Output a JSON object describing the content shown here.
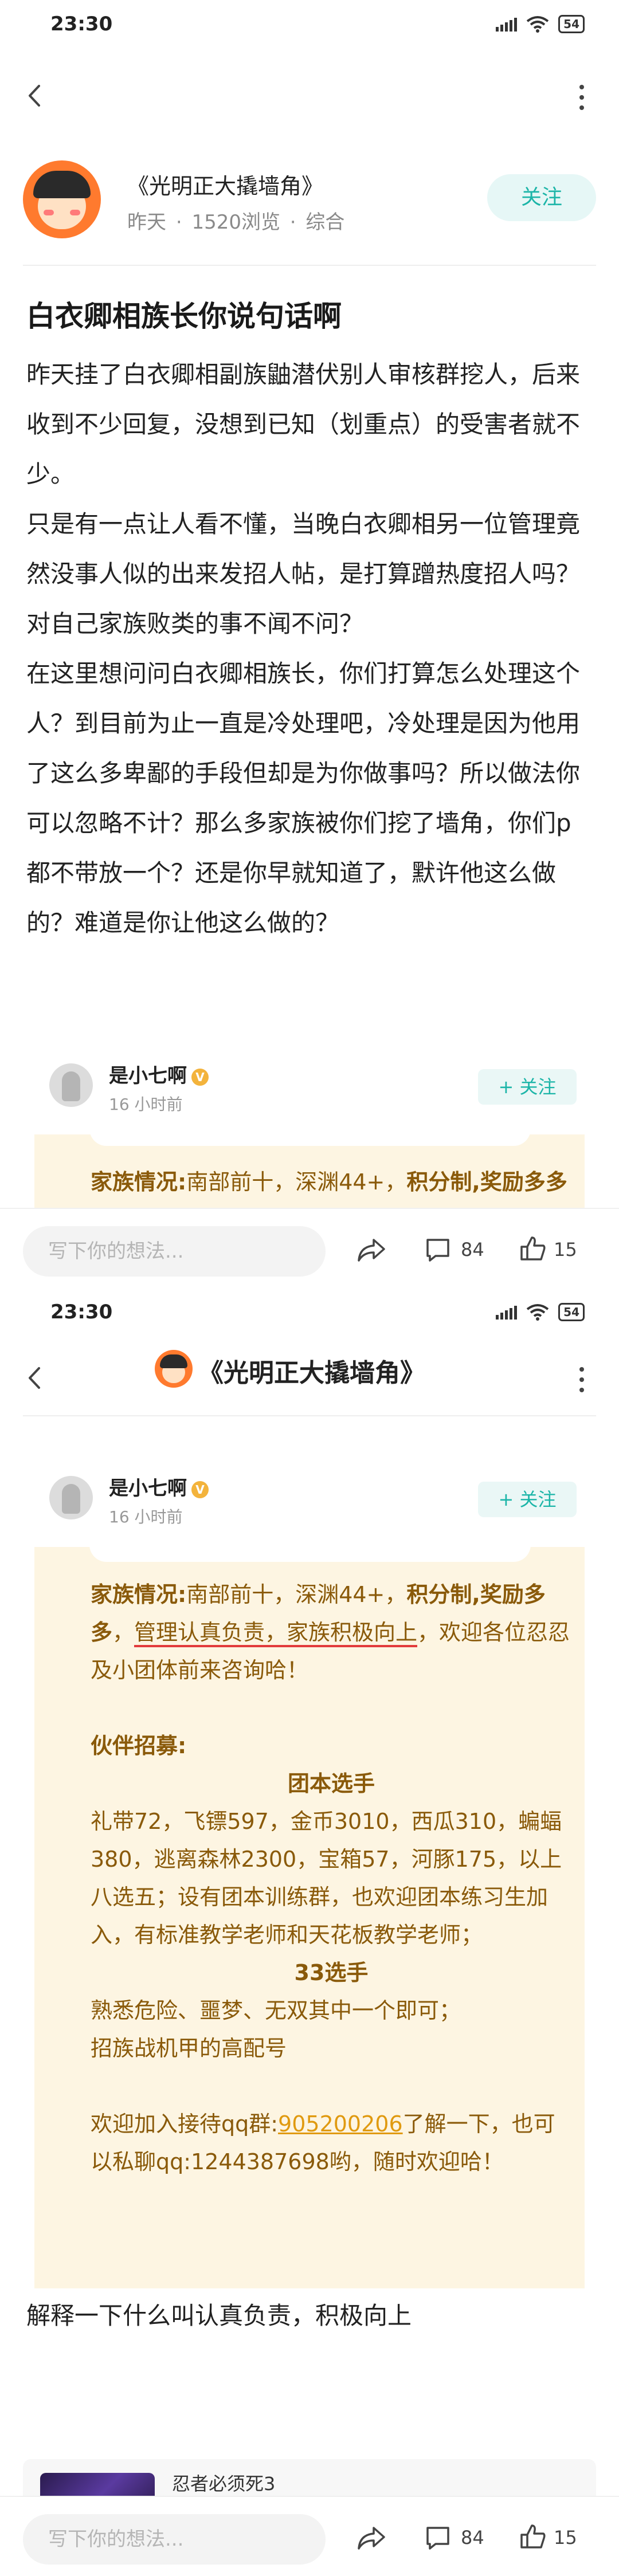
{
  "status_bar": {
    "time": "23:30",
    "battery": "54"
  },
  "post": {
    "author_name": "《光明正大撬墙角》",
    "meta_time": "昨天",
    "meta_views": "1520浏览",
    "meta_category": "综合",
    "follow_label": "关注",
    "title": "白衣卿相族长你说句话啊",
    "paragraphs": [
      "昨天挂了白衣卿相副族鼬潜伏别人审核群挖人，后来收到不少回复，没想到已知（划重点）的受害者就不少。",
      "只是有一点让人看不懂，当晚白衣卿相另一位管理竟然没事人似的出来发招人帖，是打算蹭热度招人吗？对自己家族败类的事不闻不问？",
      "在这里想问问白衣卿相族长，你们打算怎么处理这个人？到目前为止一直是冷处理吧，冷处理是因为他用了这么多卑鄙的手段但却是为你做事吗？所以做法你可以忽略不计？那么多家族被你们挖了墙角，你们p都不带放一个？还是你早就知道了，默许他这么做的？难道是你让他这么做的？"
    ],
    "explain_text": "解释一下什么叫认真负责，积极向上"
  },
  "comment": {
    "author": "是小七啊",
    "badge": "V",
    "time": "16 小时前",
    "follow_label": "+ 关注",
    "family_label": "家族情况:",
    "family_text": "南部前十，深渊44+，",
    "family_bold": "积分制,奖励多多",
    "family_sep": "，",
    "family_underlined": "管理认真负责，家族积极向上",
    "family_tail": "，欢迎各位忍忍及小团体前来咨询哈！",
    "partner_heading": "伙伴招募:",
    "group_heading": "团本选手",
    "group_text": "礼带72，飞镖597，金币3010，西瓜310，蝙蝠380，逃离森林2300，宝箱57，河豚175，以上八选五；设有团本训练群，也欢迎团本练习生加入，有标准教学老师和天花板教学老师；",
    "heading_33": "33选手",
    "text_33": "熟悉危险、噩梦、无双其中一个即可；",
    "recruit_text": "招族战机甲的高配号",
    "welcome_prefix": "欢迎加入接待qq群:",
    "qq_group": "905200206",
    "welcome_suffix": "了解一下，也可以私聊qq:1244387698哟，随时欢迎哈！"
  },
  "action_bar": {
    "placeholder": "写下你的想法...",
    "comment_count": "84",
    "like_count": "15"
  },
  "related": {
    "title": "忍者必须死3"
  },
  "colors": {
    "accent": "#1cb5a8",
    "card_bg": "#fdf5e2",
    "card_text": "#8a5a0a",
    "link": "#e09a10",
    "underline": "#e23b3b"
  }
}
